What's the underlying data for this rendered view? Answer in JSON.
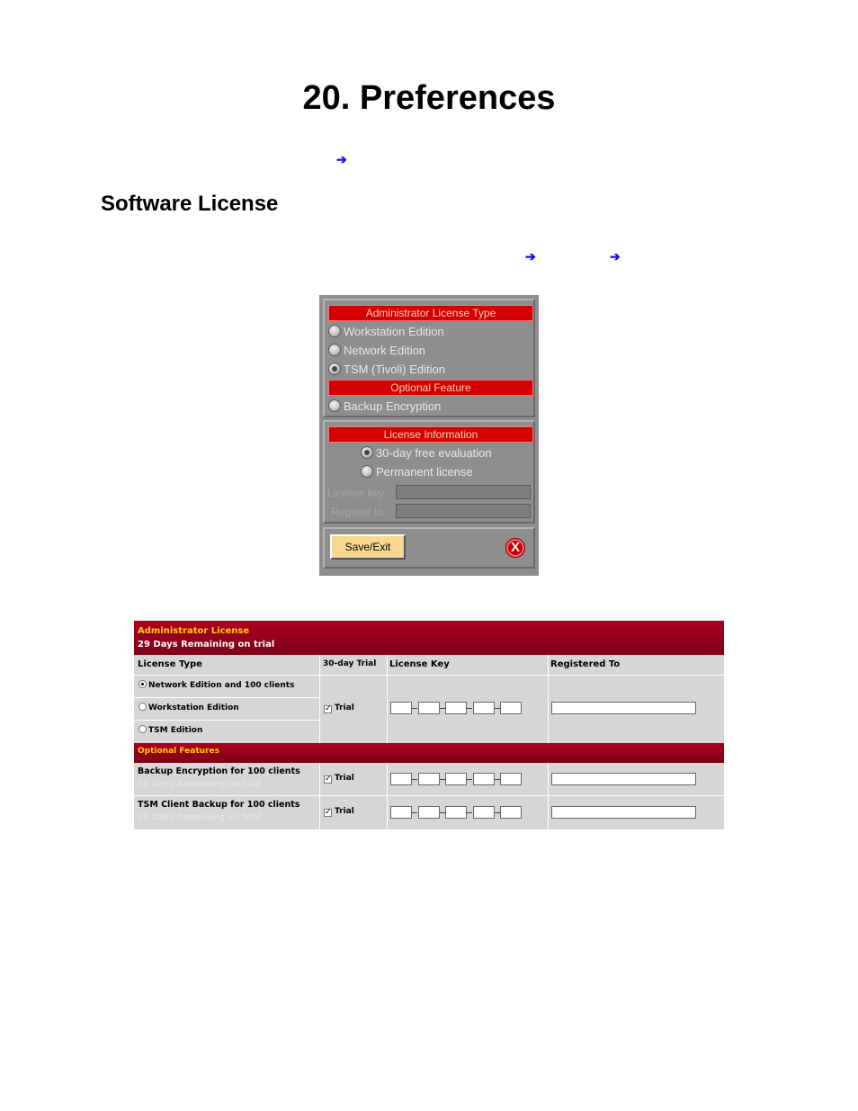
{
  "page": {
    "title": "20. Preferences",
    "section_title": "Software License"
  },
  "license_dialog": {
    "admin_license_type_header": "Administrator License Type",
    "license_types": [
      {
        "label": "Workstation Edition",
        "selected": false
      },
      {
        "label": "Network Edition",
        "selected": false
      },
      {
        "label": "TSM (Tivoli) Edition",
        "selected": true
      }
    ],
    "optional_feature_header": "Optional Feature",
    "optional_features": [
      {
        "label": "Backup Encryption",
        "selected": false
      }
    ],
    "license_info_header": "License Information",
    "license_options": [
      {
        "label": "30-day free evaluation",
        "selected": true
      },
      {
        "label": "Permanent license",
        "selected": false
      }
    ],
    "license_key_label": "License key:",
    "license_key_value": "",
    "register_to_label": "Register to:",
    "register_to_value": "",
    "save_label": "Save/Exit",
    "close_glyph": "X"
  },
  "web_license": {
    "header_title": "Administrator License",
    "header_subtitle": "29 Days Remaining on trial",
    "columns": [
      "License Type",
      "30-day Trial",
      "License Key",
      "Registered To"
    ],
    "license_types": [
      {
        "label": "Network Edition and 100 clients",
        "selected": true
      },
      {
        "label": "Workstation Edition",
        "selected": false
      },
      {
        "label": "TSM Edition",
        "selected": false
      }
    ],
    "trial_label": "Trial",
    "trial_checked": true,
    "optional_header": "Optional Features",
    "features": [
      {
        "name": "Backup Encryption for 100 clients",
        "remaining": "30 Days Remaining on trial",
        "trial_label": "Trial",
        "trial_checked": true
      },
      {
        "name": "TSM Client Backup for 100 clients",
        "remaining": "30 Days Remaining on trial",
        "trial_label": "Trial",
        "trial_checked": true
      }
    ]
  },
  "colors": {
    "dialog_gray": "#8e8e8e",
    "dialog_red": "#d40000",
    "button_yellow": "#f8d890",
    "web_header_red": "#b00020",
    "link_arrow_blue": "#1010ee"
  },
  "icons": {
    "nav_arrow": "right-arrow-icon",
    "close": "close-circle-icon"
  }
}
